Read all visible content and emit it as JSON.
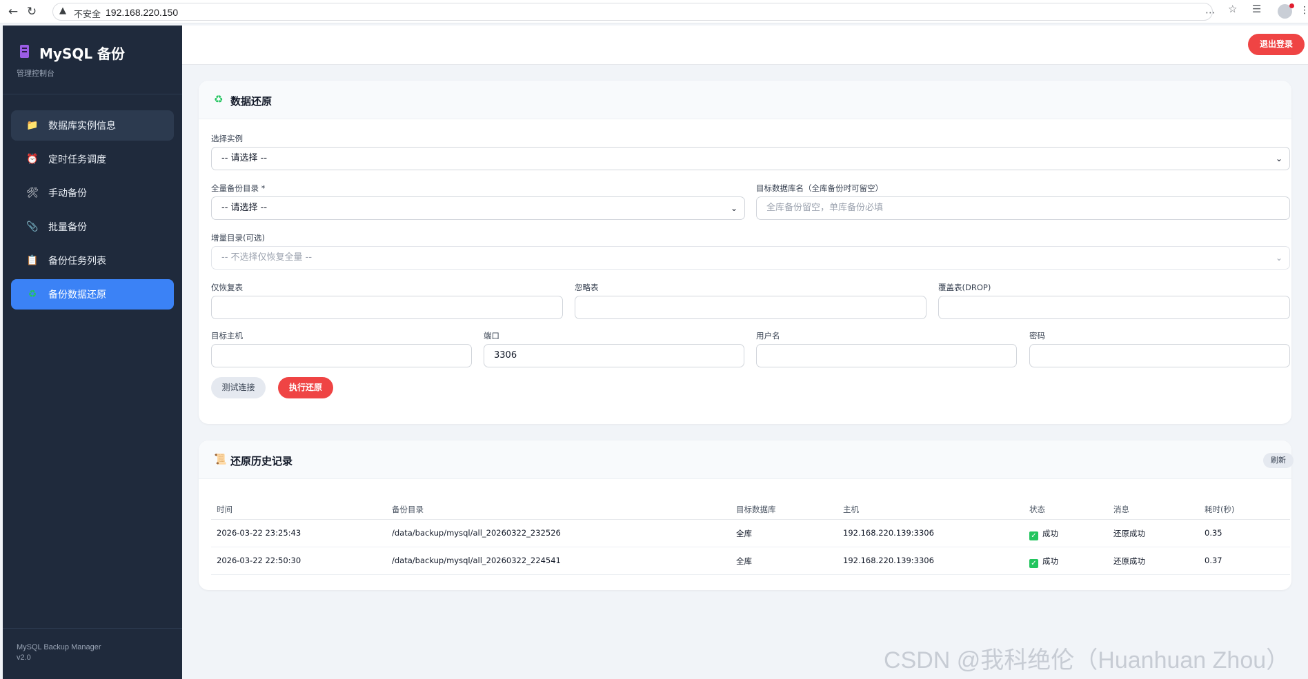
{
  "browser": {
    "back_icon": "←",
    "reload_icon": "↻",
    "warning_icon": "▲",
    "insecure_label": "不安全",
    "url": "192.168.220.150"
  },
  "sidebar": {
    "title": "MySQL 备份",
    "subtitle": "管理控制台",
    "items": [
      {
        "icon": "📁",
        "label": "数据库实例信息"
      },
      {
        "icon": "⏰",
        "label": "定时任务调度"
      },
      {
        "icon": "🛠",
        "label": "手动备份"
      },
      {
        "icon": "📎",
        "label": "批量备份"
      },
      {
        "icon": "📋",
        "label": "备份任务列表"
      },
      {
        "icon": "♻",
        "label": "备份数据还原"
      }
    ],
    "footer_name": "MySQL Backup Manager",
    "footer_version": "v2.0"
  },
  "header": {
    "logout_label": "退出登录"
  },
  "restore_form": {
    "title_icon": "♻",
    "title": "数据还原",
    "instance_label": "选择实例",
    "instance_value": "-- 请选择 --",
    "full_dir_label": "全量备份目录 *",
    "full_dir_value": "-- 请选择 --",
    "target_db_label": "目标数据库名（全库备份时可留空）",
    "target_db_placeholder": "全库备份留空，单库备份必填",
    "incr_label": "增量目录(可选)",
    "incr_value": "-- 不选择仅恢复全量 --",
    "only_tables_label": "仅恢复表",
    "ignore_tables_label": "忽略表",
    "drop_tables_label": "覆盖表(DROP)",
    "host_label": "目标主机",
    "port_label": "端口",
    "port_value": "3306",
    "user_label": "用户名",
    "password_label": "密码",
    "test_button": "测试连接",
    "execute_button": "执行还原"
  },
  "history": {
    "title_icon": "📜",
    "title": "还原历史记录",
    "refresh_button": "刷新",
    "columns": [
      "时间",
      "备份目录",
      "目标数据库",
      "主机",
      "状态",
      "消息",
      "耗时(秒)"
    ],
    "rows": [
      {
        "time": "2026-03-22 23:25:43",
        "dir": "/data/backup/mysql/all_20260322_232526",
        "db": "全库",
        "host": "192.168.220.139:3306",
        "status": "成功",
        "message": "还原成功",
        "duration": "0.35"
      },
      {
        "time": "2026-03-22 22:50:30",
        "dir": "/data/backup/mysql/all_20260322_224541",
        "db": "全库",
        "host": "192.168.220.139:3306",
        "status": "成功",
        "message": "还原成功",
        "duration": "0.37"
      }
    ],
    "status_icon": "✓"
  },
  "watermark": "CSDN @我科绝伦（Huanhuan Zhou）",
  "colors": {
    "sidebar_bg": "#1f2a3c",
    "accent": "#3b82f6",
    "danger": "#ef4444",
    "success": "#22c55e"
  }
}
